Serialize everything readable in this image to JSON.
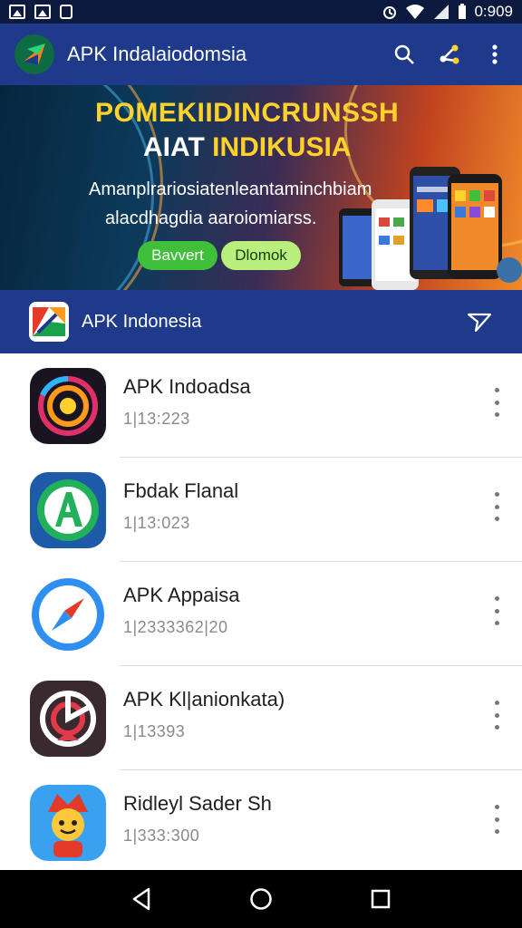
{
  "status_bar": {
    "time": "0:909",
    "icons": [
      "image-icon",
      "image-icon",
      "lock-icon",
      "alarm-icon",
      "wifi-icon",
      "signal-icon",
      "battery-icon"
    ]
  },
  "app_bar": {
    "title": "APK Indalaiodomsia",
    "actions": [
      "search-icon",
      "share-icon",
      "more-vert-icon"
    ]
  },
  "banner": {
    "headline_1": "POMEKIIDINCRUNSSH",
    "headline_2_white": "AIAT",
    "headline_2_yellow": "INDIKUSIA",
    "subtitle_1": "Amanplrariosiatenleantaminchbiam",
    "subtitle_2": "alacdhagdia aaroiomiarss.",
    "primary_button": "Bavvert",
    "secondary_button": "Dlomok"
  },
  "section": {
    "title": "APK Indonesia",
    "action_icon": "filter-send-icon"
  },
  "apps": [
    {
      "name": "APK Indoadsa",
      "meta": "1|13:223"
    },
    {
      "name": "Fbdak Flanal",
      "meta": "1|13:023"
    },
    {
      "name": "APK Appaisa",
      "meta": "1|2333362|20"
    },
    {
      "name": "APK Kl|anionkata)",
      "meta": "1|13393"
    },
    {
      "name": "Ridleyl Sader Sh",
      "meta": "1|333:300"
    }
  ],
  "colors": {
    "primary": "#1f3a8a",
    "status_bar": "#0d1a3f",
    "accent_yellow": "#ffd22b",
    "button_green": "#3fbf3a"
  },
  "nav_bar": [
    "back-icon",
    "home-icon",
    "recents-icon"
  ]
}
